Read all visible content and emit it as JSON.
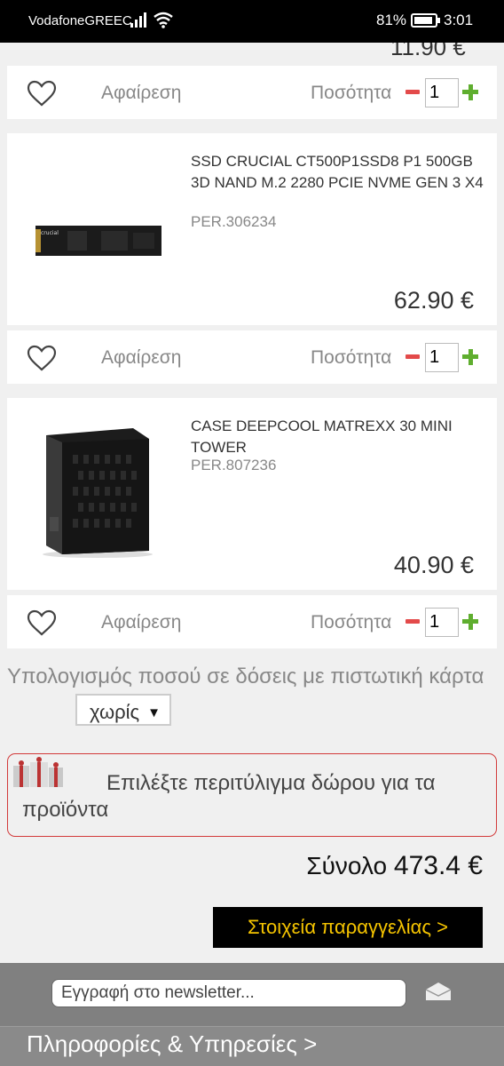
{
  "status_bar": {
    "carrier": "VodafoneGREEC",
    "battery": "81%",
    "time": "3:01"
  },
  "previous_item": {
    "price": "11.90 €"
  },
  "cart": {
    "remove_label": "Αφαίρεση",
    "quantity_label": "Ποσότητα",
    "items": [
      {
        "title": "",
        "code": "",
        "price": "11.90 €",
        "quantity": "1"
      },
      {
        "title": "SSD CRUCIAL CT500P1SSD8 P1 500GB 3D NAND M.2 2280 PCIE NVME GEN 3 X4",
        "code": "PER.306234",
        "price": "62.90 €",
        "quantity": "1"
      },
      {
        "title": "CASE DEEPCOOL MATREXX 30 MINI TOWER",
        "code": "PER.807236",
        "price": "40.90 €",
        "quantity": "1"
      }
    ]
  },
  "installments": {
    "label": "Υπολογισμός ποσού σε δόσεις με πιστωτική κάρτα",
    "selected": "χωρίς"
  },
  "gift_wrap": {
    "text": "Επιλέξτε περιτύλιγμα δώρου για τα προϊόντα"
  },
  "summary": {
    "total_label": "Σύνολο",
    "total_value": "473.4 €",
    "order_button": "Στοιχεία παραγγελίας >"
  },
  "footer": {
    "newsletter_placeholder": "Εγγραφή στο newsletter...",
    "info_link": "Πληροφορίες & Υπηρεσίες >"
  },
  "colors": {
    "accent_button_text": "#f5c400",
    "minus": "#e34a4a",
    "plus": "#5fae2f",
    "gift_border": "#d23a3a"
  }
}
